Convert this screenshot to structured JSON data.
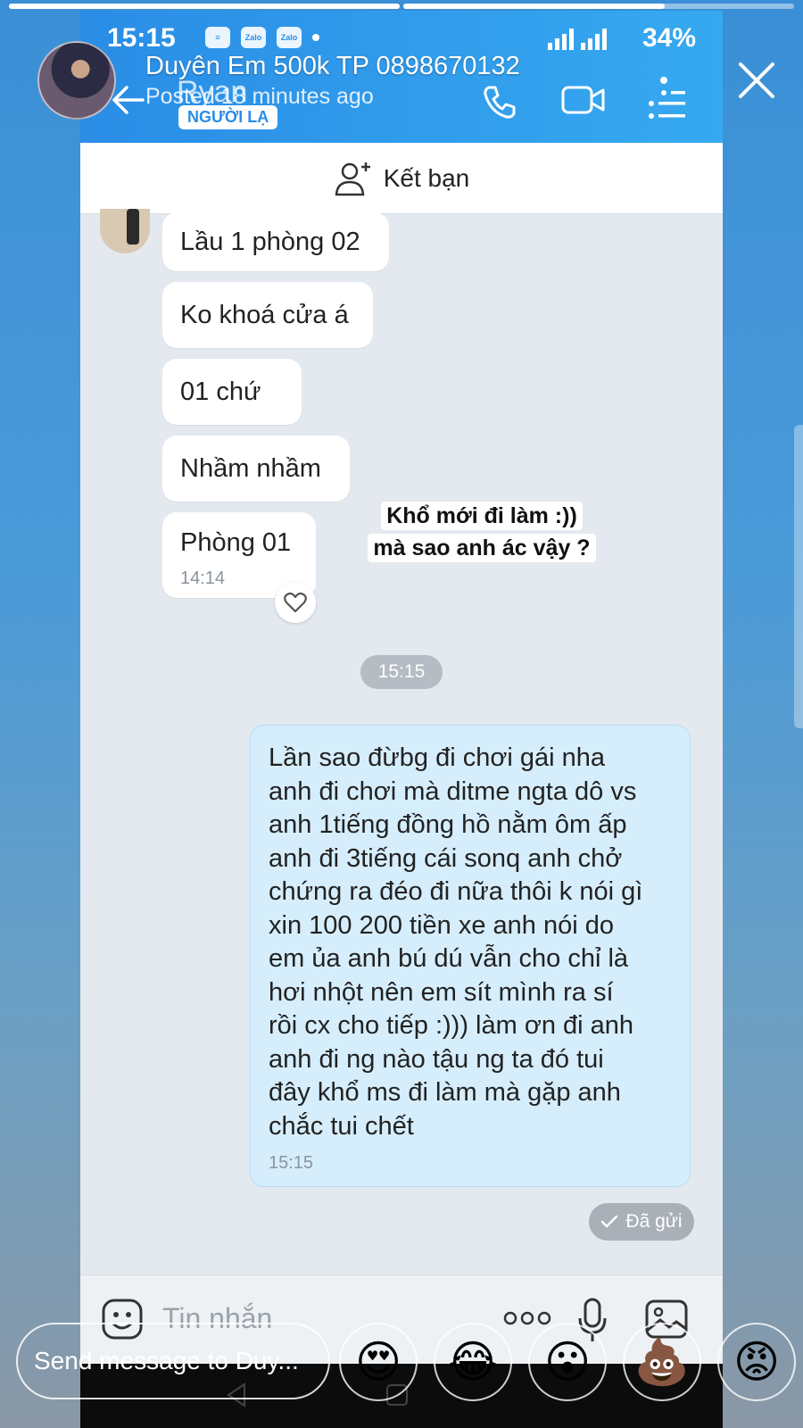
{
  "story": {
    "progress": [
      1.0,
      0.67
    ],
    "poster_name": "Duyên Em 500k TP 0898670132",
    "posted_time": "Posted 18 minutes ago",
    "caption_line1": "Khổ mới đi làm :))",
    "caption_line2": "mà sao anh ác vậy ?",
    "reply_placeholder": "Send message to Duy...",
    "reactions": [
      {
        "icon": "heart-eyes-emoji",
        "glyph": "😍"
      },
      {
        "icon": "laugh-crying-emoji",
        "glyph": "😂"
      },
      {
        "icon": "surprised-emoji",
        "glyph": "😮"
      },
      {
        "icon": "poop-emoji",
        "glyph": "💩"
      },
      {
        "icon": "angry-emoji",
        "glyph": "😡"
      }
    ]
  },
  "screenshot": {
    "status_time": "15:15",
    "status_apps": [
      "Zalo",
      "Zalo"
    ],
    "battery": "34%",
    "chat_name": "Ryan",
    "stranger_badge": "NGƯỜI LẠ",
    "add_friend_label": "Kết bạn",
    "incoming": [
      {
        "text": "Lầu 1 phòng 02"
      },
      {
        "text": "Ko khoá cửa á"
      },
      {
        "text": "01 chứ"
      },
      {
        "text": "Nhầm nhầm"
      },
      {
        "text": "Phòng 01",
        "time": "14:14"
      }
    ],
    "time_divider": "15:15",
    "outgoing_text": "Lần sao đừbg đi chơi gái nha\nanh đi chơi mà ditme ngta dô vs\nanh 1tiếng đồng hồ nằm ôm ấp\nanh đi 3tiếng cái sonq anh chở\nchứng ra đéo đi nữa thôi k nói gì\nxin 100 200 tiền xe anh nói do\nem ủa anh bú dú vẫn cho chỉ là\nhơi nhột nên em sít mình ra sí\nrồi cx cho tiếp :))) làm ơn đi anh\nanh đi ng nào tậu ng ta đó tui\nđây khổ ms đi làm mà gặp anh\nchắc tui chết",
    "outgoing_time": "15:15",
    "sent_status": "Đã gửi",
    "input_placeholder": "Tin nhắn"
  },
  "colors": {
    "zalo_blue": "#2a8de6",
    "outgoing_bubble": "#d6eefc",
    "chat_bg": "#e3e9ef"
  }
}
